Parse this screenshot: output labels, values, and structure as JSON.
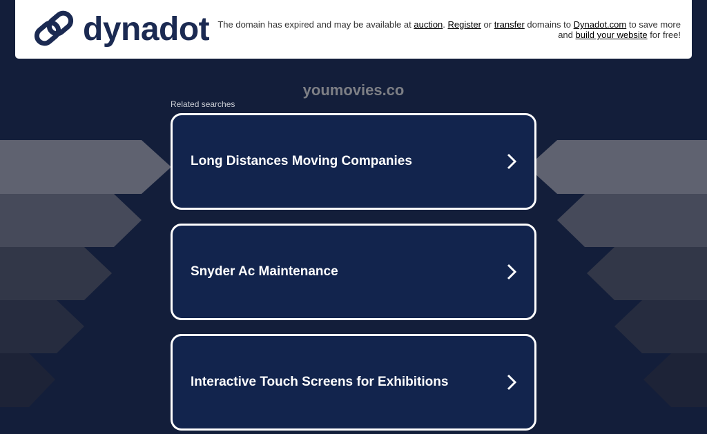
{
  "header": {
    "logo_text": "dynadot",
    "notice": {
      "part1": "The domain has expired and may be available at ",
      "auction_link": "auction",
      "part2": ". ",
      "register_link": "Register",
      "part3": " or ",
      "transfer_link": "transfer",
      "part4": " domains to ",
      "dynadot_link": "Dynadot.com",
      "part5": " to save more and ",
      "build_link": "build your website",
      "part6": " for free!"
    }
  },
  "domain": "youmovies.co",
  "related_label": "Related searches",
  "searches": [
    {
      "label": "Long Distances Moving Companies"
    },
    {
      "label": "Snyder Ac Maintenance"
    },
    {
      "label": "Interactive Touch Screens for Exhibitions"
    }
  ],
  "colors": {
    "background": "#131e3a",
    "card": "#12244d",
    "logo": "#1b2a52"
  }
}
